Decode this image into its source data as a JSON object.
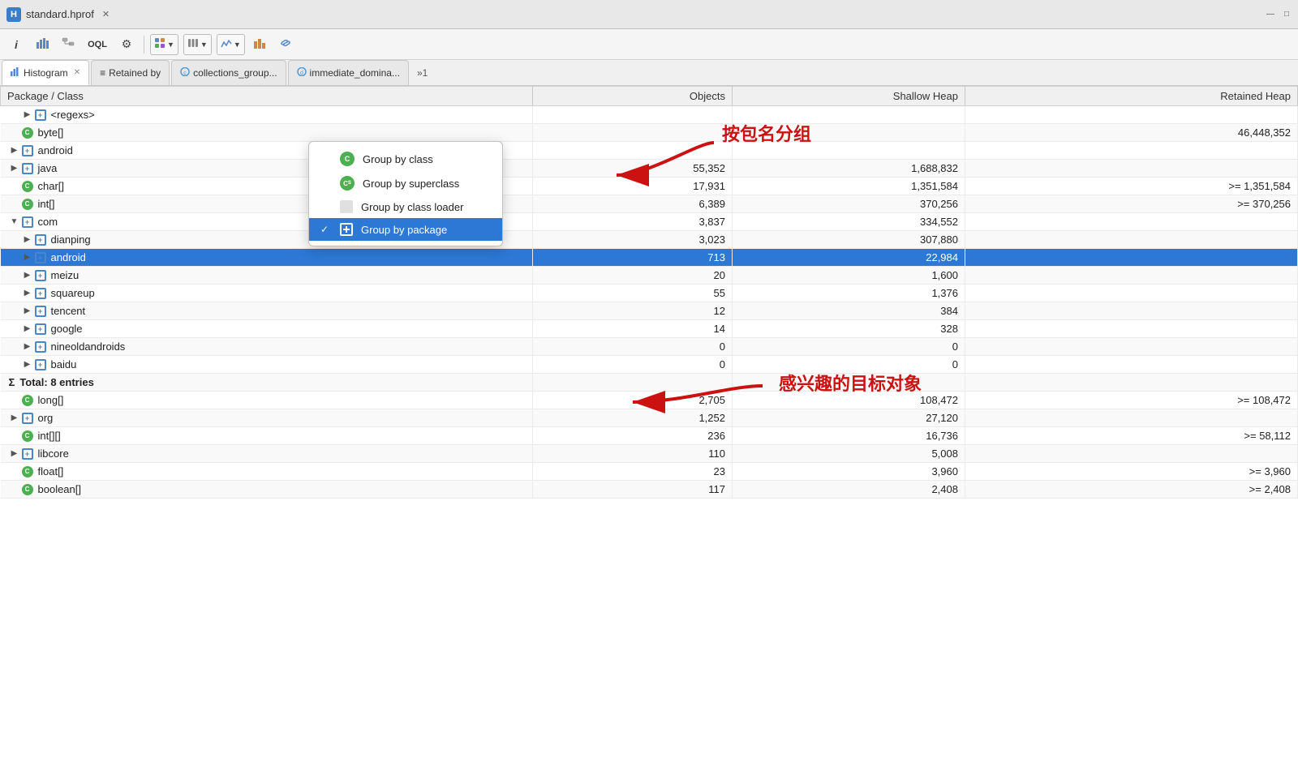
{
  "titleBar": {
    "icon": "H",
    "title": "standard.hprof",
    "closeIcon": "✕",
    "winMinLabel": "—",
    "winMaxLabel": "□"
  },
  "toolbar": {
    "buttons": [
      {
        "name": "info-btn",
        "label": "ℹ",
        "interactable": true
      },
      {
        "name": "chart-btn",
        "label": "📊",
        "interactable": true
      },
      {
        "name": "class-btn",
        "label": "🗂",
        "interactable": true
      },
      {
        "name": "oql-btn",
        "label": "OQL",
        "interactable": true
      },
      {
        "name": "gear-btn",
        "label": "⚙",
        "interactable": true
      },
      {
        "name": "export-btn",
        "label": "📤",
        "interactable": true
      },
      {
        "name": "search-btn",
        "label": "🔍",
        "interactable": true
      },
      {
        "name": "group-dropdown",
        "label": "▼",
        "interactable": true
      },
      {
        "name": "columns-btn",
        "label": "≡",
        "interactable": true
      },
      {
        "name": "calc-btn",
        "label": "📈",
        "interactable": true
      },
      {
        "name": "bar-btn",
        "label": "▦",
        "interactable": true
      },
      {
        "name": "link-btn",
        "label": "🔗",
        "interactable": true
      }
    ]
  },
  "tabs": [
    {
      "name": "histogram-tab",
      "label": "Histogram",
      "icon": "📊",
      "active": true,
      "closeable": true
    },
    {
      "name": "retained-by-tab",
      "label": "Retained by",
      "icon": "≡",
      "active": false,
      "closeable": false
    },
    {
      "name": "collections-tab",
      "label": "collections_group...",
      "icon": "📦",
      "active": false,
      "closeable": false
    },
    {
      "name": "dominator-tab",
      "label": "immediate_domina...",
      "icon": "📦",
      "active": false,
      "closeable": false
    },
    {
      "name": "overflow-tab",
      "label": "»1",
      "interactable": true
    }
  ],
  "table": {
    "columns": [
      {
        "name": "class-col",
        "label": "Package / Class"
      },
      {
        "name": "objects-col",
        "label": "Objects"
      },
      {
        "name": "shallow-col",
        "label": "Shallow Heap"
      },
      {
        "name": "retained-col",
        "label": "Retained Heap"
      }
    ],
    "rows": [
      {
        "indent": 1,
        "type": "pkg",
        "label": "<regexs>",
        "objects": "",
        "shallow": "",
        "retained": "",
        "id": "row-regexs"
      },
      {
        "indent": 0,
        "type": "class",
        "label": "byte[]",
        "objects": "",
        "shallow": "",
        "retained": "46,448,352",
        "id": "row-byte"
      },
      {
        "indent": 0,
        "type": "pkg",
        "label": "android",
        "objects": "",
        "shallow": "",
        "retained": "",
        "id": "row-android-top",
        "collapsed": true
      },
      {
        "indent": 0,
        "type": "pkg",
        "label": "java",
        "objects": "55,352",
        "shallow": "1,688,832",
        "retained": "",
        "id": "row-java",
        "collapsed": true
      },
      {
        "indent": 0,
        "type": "class",
        "label": "char[]",
        "objects": "17,931",
        "shallow": "1,351,584",
        "retained": ">= 1,351,584",
        "id": "row-char"
      },
      {
        "indent": 0,
        "type": "class",
        "label": "int[]",
        "objects": "6,389",
        "shallow": "370,256",
        "retained": ">= 370,256",
        "id": "row-int"
      },
      {
        "indent": 0,
        "type": "pkg",
        "label": "com",
        "objects": "3,837",
        "shallow": "334,552",
        "retained": "",
        "id": "row-com",
        "expanded": true
      },
      {
        "indent": 1,
        "type": "pkg",
        "label": "dianping",
        "objects": "3,023",
        "shallow": "307,880",
        "retained": "",
        "id": "row-dianping",
        "collapsed": true
      },
      {
        "indent": 1,
        "type": "pkg",
        "label": "android",
        "objects": "713",
        "shallow": "22,984",
        "retained": "",
        "id": "row-android-com",
        "selected": true,
        "collapsed": true
      },
      {
        "indent": 1,
        "type": "pkg",
        "label": "meizu",
        "objects": "20",
        "shallow": "1,600",
        "retained": "",
        "id": "row-meizu",
        "collapsed": true
      },
      {
        "indent": 1,
        "type": "pkg",
        "label": "squareup",
        "objects": "55",
        "shallow": "1,376",
        "retained": "",
        "id": "row-squareup",
        "collapsed": true
      },
      {
        "indent": 1,
        "type": "pkg",
        "label": "tencent",
        "objects": "12",
        "shallow": "384",
        "retained": "",
        "id": "row-tencent",
        "collapsed": true
      },
      {
        "indent": 1,
        "type": "pkg",
        "label": "google",
        "objects": "14",
        "shallow": "328",
        "retained": "",
        "id": "row-google",
        "collapsed": true
      },
      {
        "indent": 1,
        "type": "pkg",
        "label": "nineoldandroids",
        "objects": "0",
        "shallow": "0",
        "retained": "",
        "id": "row-nineold",
        "collapsed": true
      },
      {
        "indent": 1,
        "type": "pkg",
        "label": "baidu",
        "objects": "0",
        "shallow": "0",
        "retained": "",
        "id": "row-baidu",
        "collapsed": true
      },
      {
        "indent": 0,
        "type": "total",
        "label": "Total: 8 entries",
        "objects": "",
        "shallow": "",
        "retained": "",
        "id": "row-total"
      },
      {
        "indent": 0,
        "type": "class",
        "label": "long[]",
        "objects": "2,705",
        "shallow": "108,472",
        "retained": ">= 108,472",
        "id": "row-long"
      },
      {
        "indent": 0,
        "type": "pkg",
        "label": "org",
        "objects": "1,252",
        "shallow": "27,120",
        "retained": "",
        "id": "row-org",
        "collapsed": true
      },
      {
        "indent": 0,
        "type": "class",
        "label": "int[][]",
        "objects": "236",
        "shallow": "16,736",
        "retained": ">= 58,112",
        "id": "row-intarr"
      },
      {
        "indent": 0,
        "type": "pkg",
        "label": "libcore",
        "objects": "110",
        "shallow": "5,008",
        "retained": "",
        "id": "row-libcore",
        "collapsed": true
      },
      {
        "indent": 0,
        "type": "class",
        "label": "float[]",
        "objects": "23",
        "shallow": "3,960",
        "retained": ">= 3,960",
        "id": "row-float"
      },
      {
        "indent": 0,
        "type": "class",
        "label": "boolean[]",
        "objects": "117",
        "shallow": "2,408",
        "retained": ">= 2,408",
        "id": "row-boolean"
      }
    ]
  },
  "dropdownMenu": {
    "items": [
      {
        "name": "group-by-class",
        "label": "Group by class",
        "icon": "class",
        "checked": false
      },
      {
        "name": "group-by-superclass",
        "label": "Group by superclass",
        "icon": "class-s",
        "checked": false
      },
      {
        "name": "group-by-classloader",
        "label": "Group by class loader",
        "icon": "loader",
        "checked": false
      },
      {
        "name": "group-by-package",
        "label": "Group by package",
        "icon": "pkg",
        "checked": true,
        "selected": true
      }
    ]
  },
  "annotations": {
    "text1": "按包名分组",
    "text2": "感兴趣的目标对象"
  }
}
